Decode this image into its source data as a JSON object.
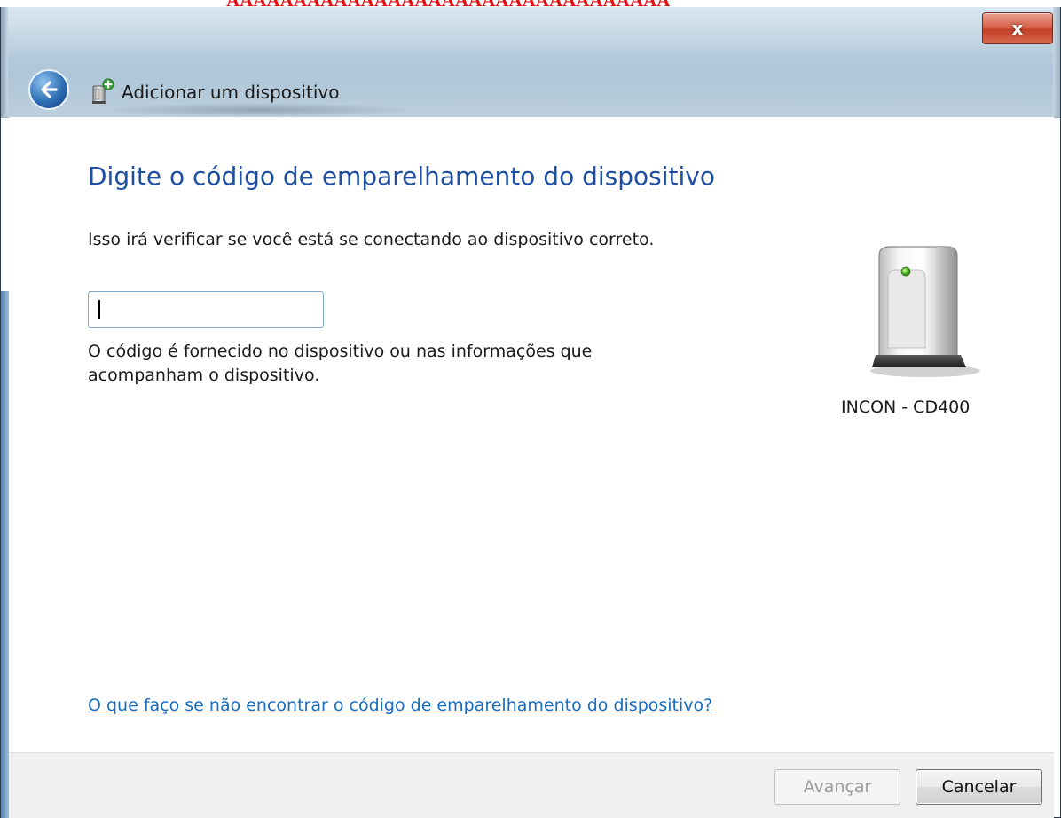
{
  "banner": {
    "text": "AAAAAAAAAAAAAAAAAAAAAAAAAAAAAAAAA"
  },
  "window": {
    "title": "Adicionar um dispositivo",
    "close_label": "x"
  },
  "main": {
    "heading": "Digite o código de emparelhamento do dispositivo",
    "instruction": "Isso irá verificar se você está se conectando ao dispositivo correto.",
    "code_input_value": "",
    "help_text": "O código é fornecido no dispositivo ou nas informações que acompanham o dispositivo.",
    "help_link": "O que faço se não encontrar o código de emparelhamento do dispositivo?"
  },
  "device": {
    "name": "INCON - CD400",
    "icon": "generic-device-icon"
  },
  "footer": {
    "next_label": "Avançar",
    "next_enabled": false,
    "cancel_label": "Cancelar"
  },
  "colors": {
    "heading": "#1e4fa3",
    "link": "#1a6cc0",
    "banner": "#e01010",
    "close": "#c2402a"
  }
}
